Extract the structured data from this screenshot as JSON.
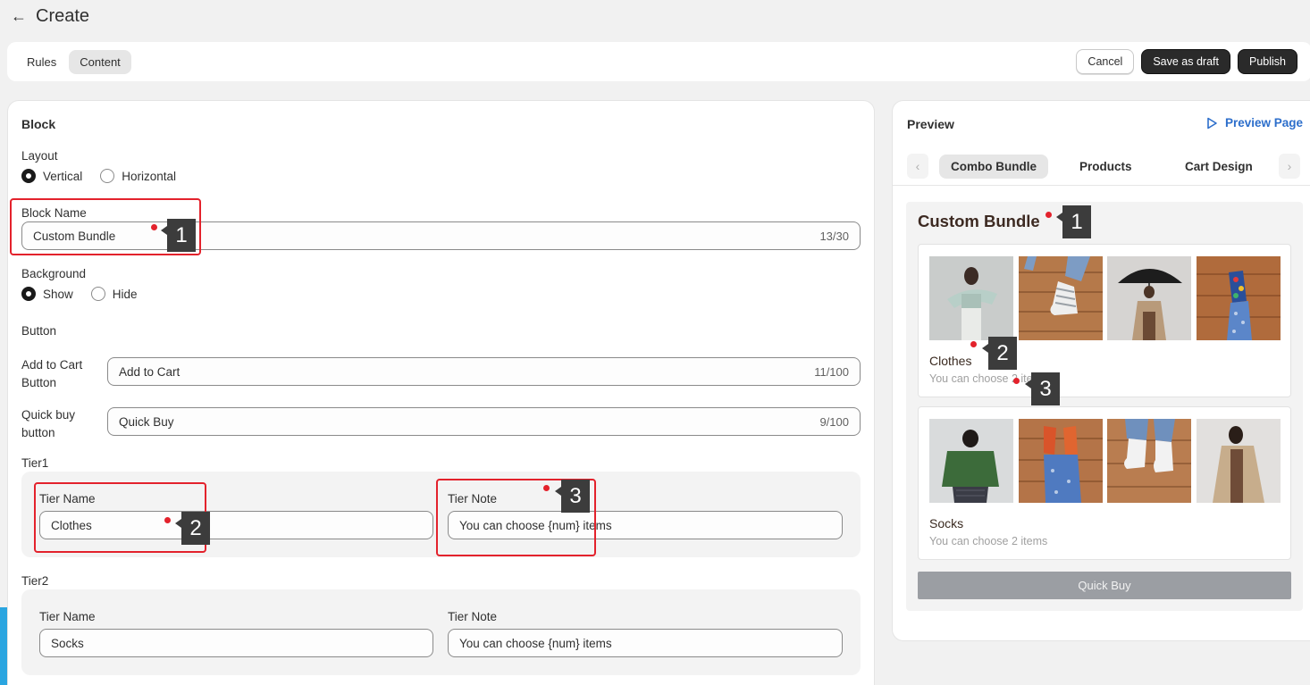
{
  "header": {
    "title": "Create"
  },
  "tabs": [
    {
      "label": "Rules",
      "active": false
    },
    {
      "label": "Content",
      "active": true
    }
  ],
  "actions": {
    "cancel": "Cancel",
    "save_draft": "Save as draft",
    "publish": "Publish"
  },
  "block": {
    "title": "Block",
    "layout": {
      "label": "Layout",
      "options": [
        "Vertical",
        "Horizontal"
      ],
      "selected": "Vertical"
    },
    "block_name": {
      "label": "Block Name",
      "value": "Custom Bundle",
      "count": "13/30"
    },
    "background": {
      "label": "Background",
      "options": [
        "Show",
        "Hide"
      ],
      "selected": "Show"
    },
    "button": {
      "label": "Button",
      "add_to_cart": {
        "label_line1": "Add to Cart",
        "label_line2": "Button",
        "value": "Add to Cart",
        "count": "11/100"
      },
      "quick_buy": {
        "label_line1": "Quick buy",
        "label_line2": "button",
        "value": "Quick Buy",
        "count": "9/100"
      }
    },
    "tiers": [
      {
        "label": "Tier1",
        "name_label": "Tier Name",
        "name": "Clothes",
        "note_label": "Tier Note",
        "note": "You can choose {num} items"
      },
      {
        "label": "Tier2",
        "name_label": "Tier Name",
        "name": "Socks",
        "note_label": "Tier Note",
        "note": "You can choose {num} items"
      }
    ]
  },
  "preview": {
    "title": "Preview",
    "preview_page": "Preview Page",
    "tabs": [
      "Combo Bundle",
      "Products",
      "Cart Design"
    ],
    "active_tab": "Combo Bundle",
    "bundle_title": "Custom Bundle",
    "tiers": [
      {
        "name": "Clothes",
        "note": "You can choose 2 items",
        "images": [
          "woman-white-outfit",
          "striped-socks",
          "woman-umbrella",
          "patterned-socks"
        ]
      },
      {
        "name": "Socks",
        "note": "You can choose 2 items",
        "images": [
          "woman-green-jacket",
          "orange-socks",
          "white-socks",
          "woman-trench-coat"
        ]
      }
    ],
    "quick_buy": "Quick Buy"
  },
  "annotations": [
    "1",
    "2",
    "3"
  ],
  "colors": {
    "annotation_red": "#e3222c",
    "primary_button": "#2a2a2a",
    "link_blue": "#2c6ecb"
  }
}
